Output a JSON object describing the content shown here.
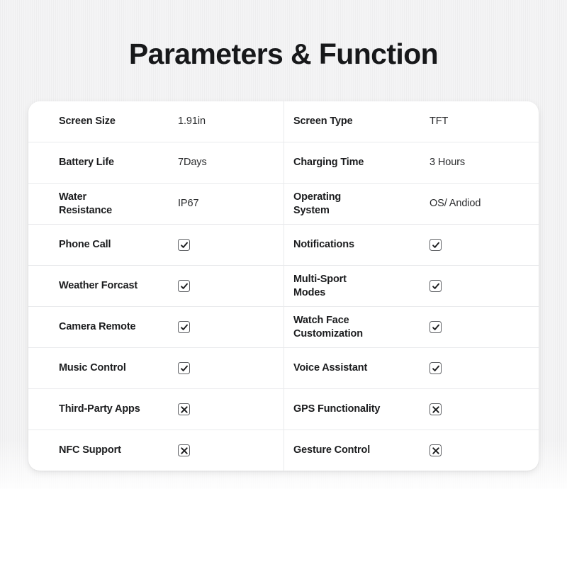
{
  "page": {
    "title": "Parameters & Function",
    "background_color": "#f4f4f5",
    "card_color": "#ffffff",
    "text_color": "#1b1c1e",
    "divider_color": "#e9eaec",
    "mark_border_color": "#5d5f63"
  },
  "spec_table": {
    "rows": [
      {
        "left": {
          "label": "Screen Size",
          "type": "text",
          "value": "1.91in"
        },
        "right": {
          "label": "Screen Type",
          "type": "text",
          "value": "TFT"
        }
      },
      {
        "left": {
          "label": "Battery Life",
          "type": "text",
          "value": "7Days"
        },
        "right": {
          "label": "Charging Time",
          "type": "text",
          "value": "3 Hours"
        }
      },
      {
        "left": {
          "label": "Water\nResistance",
          "type": "text",
          "value": "IP67"
        },
        "right": {
          "label": "Operating\nSystem",
          "type": "text",
          "value": "OS/ Andiod"
        }
      },
      {
        "left": {
          "label": "Phone Call",
          "type": "mark",
          "value": "check"
        },
        "right": {
          "label": "Notifications",
          "type": "mark",
          "value": "check"
        }
      },
      {
        "left": {
          "label": "Weather Forcast",
          "type": "mark",
          "value": "check"
        },
        "right": {
          "label": "Multi-Sport\nModes",
          "type": "mark",
          "value": "check"
        }
      },
      {
        "left": {
          "label": "Camera Remote",
          "type": "mark",
          "value": "check"
        },
        "right": {
          "label": "Watch Face\nCustomization",
          "type": "mark",
          "value": "check"
        }
      },
      {
        "left": {
          "label": "Music Control",
          "type": "mark",
          "value": "check"
        },
        "right": {
          "label": "Voice Assistant",
          "type": "mark",
          "value": "check"
        }
      },
      {
        "left": {
          "label": "Third-Party Apps",
          "type": "mark",
          "value": "cross"
        },
        "right": {
          "label": "GPS Functionality",
          "type": "mark",
          "value": "cross"
        }
      },
      {
        "left": {
          "label": "NFC Support",
          "type": "mark",
          "value": "cross"
        },
        "right": {
          "label": "Gesture Control",
          "type": "mark",
          "value": "cross"
        }
      }
    ]
  }
}
